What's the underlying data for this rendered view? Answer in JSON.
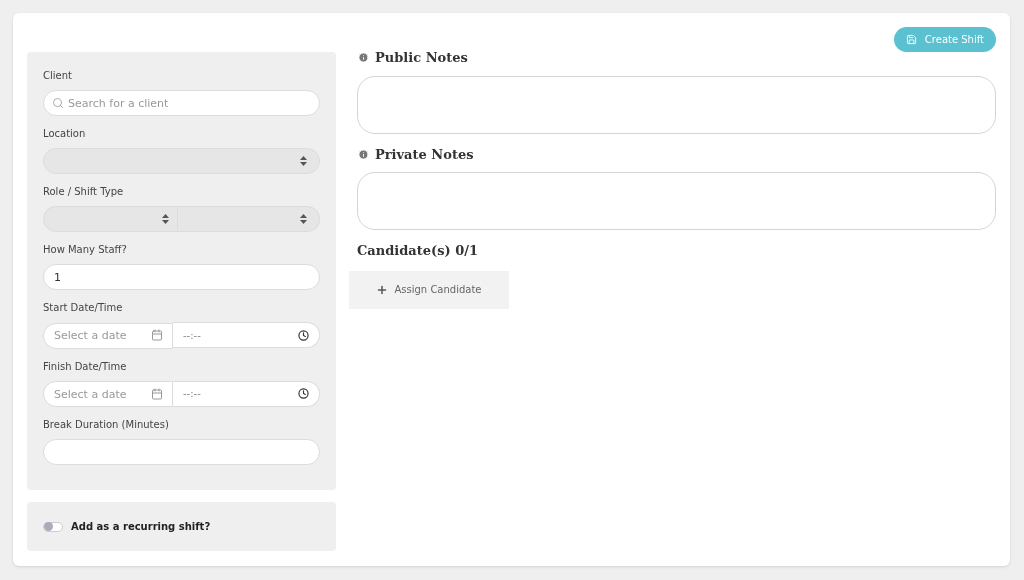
{
  "create_button": {
    "label": "Create Shift"
  },
  "fields": [
    {
      "kind": "search",
      "label": "Client",
      "placeholder": "Search for a client"
    },
    {
      "kind": "select",
      "label": "Location"
    },
    {
      "kind": "double_select",
      "label": "Role / Shift Type"
    },
    {
      "kind": "text",
      "label": "How Many Staff?",
      "value": "1"
    },
    {
      "kind": "datetime",
      "label": "Start Date/Time",
      "placeholder": "Select a date",
      "time": "--:--"
    },
    {
      "kind": "datetime",
      "label": "Finish Date/Time",
      "placeholder": "Select a date",
      "time": "--:--"
    },
    {
      "kind": "text",
      "label": "Break Duration (Minutes)"
    }
  ],
  "recurring": {
    "label": "Add as a recurring shift?",
    "on": false
  },
  "notes": [
    {
      "title": "Public Notes"
    },
    {
      "title": "Private Notes"
    }
  ],
  "candidates": {
    "title": "Candidate(s) 0/1",
    "button": "Assign Candidate"
  }
}
